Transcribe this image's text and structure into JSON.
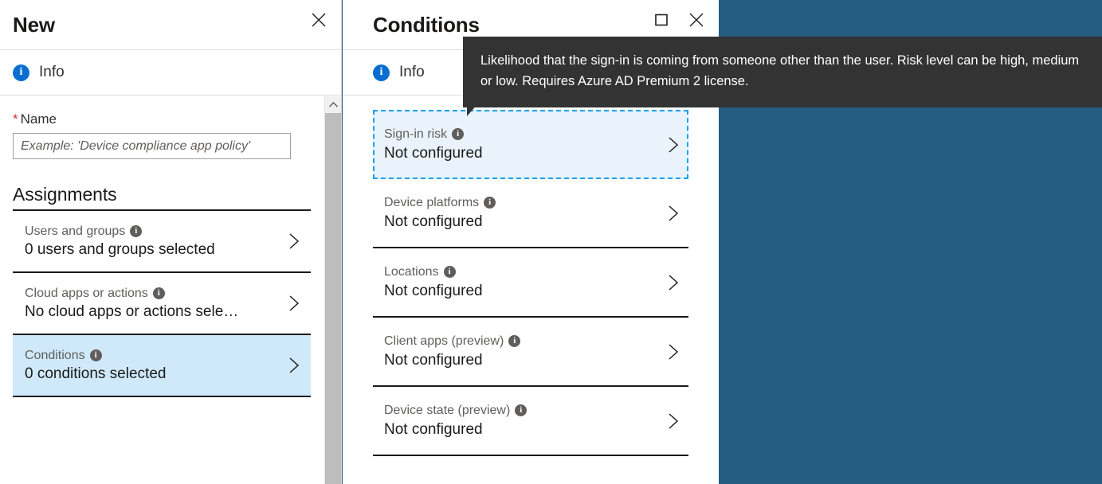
{
  "background_color": "#255d82",
  "accent_blue": "#0a6ed1",
  "focus_outline_color": "#00a2e8",
  "selected_row_color": "#cfe9fb",
  "blade_new": {
    "title": "New",
    "close_label": "Close",
    "info": {
      "icon": "info-circle-icon",
      "label": "Info"
    },
    "name_field": {
      "required_marker": "*",
      "label": "Name",
      "value": "",
      "placeholder": "Example: 'Device compliance app policy'"
    },
    "assignments": {
      "heading": "Assignments",
      "rows": [
        {
          "label": "Users and groups",
          "value": "0 users and groups selected",
          "info_icon": "info-circle-icon",
          "chevron": "chevron-right-icon",
          "selected": false
        },
        {
          "label": "Cloud apps or actions",
          "value": "No cloud apps or actions sele…",
          "info_icon": "info-circle-icon",
          "chevron": "chevron-right-icon",
          "selected": false
        },
        {
          "label": "Conditions",
          "value": "0 conditions selected",
          "info_icon": "info-circle-icon",
          "chevron": "chevron-right-icon",
          "selected": true
        }
      ]
    },
    "scrollbar": {
      "up_arrow": "chevron-up-icon"
    }
  },
  "blade_conditions": {
    "title": "Conditions",
    "maximize_label": "Maximize",
    "close_label": "Close",
    "info": {
      "icon": "info-circle-icon",
      "label": "Info"
    },
    "rows": [
      {
        "label": "Sign-in risk",
        "value": "Not configured",
        "info_icon": "info-circle-icon",
        "chevron": "chevron-right-icon",
        "focused": true
      },
      {
        "label": "Device platforms",
        "value": "Not configured",
        "info_icon": "info-circle-icon",
        "chevron": "chevron-right-icon",
        "focused": false
      },
      {
        "label": "Locations",
        "value": "Not configured",
        "info_icon": "info-circle-icon",
        "chevron": "chevron-right-icon",
        "focused": false
      },
      {
        "label": "Client apps (preview)",
        "value": "Not configured",
        "info_icon": "info-circle-icon",
        "chevron": "chevron-right-icon",
        "focused": false
      },
      {
        "label": "Device state (preview)",
        "value": "Not configured",
        "info_icon": "info-circle-icon",
        "chevron": "chevron-right-icon",
        "focused": false
      }
    ]
  },
  "tooltip": {
    "text": "Likelihood that the sign-in is coming from someone other than the user. Risk level can be high, medium or low. Requires Azure AD Premium 2 license.",
    "background": "#333333"
  }
}
